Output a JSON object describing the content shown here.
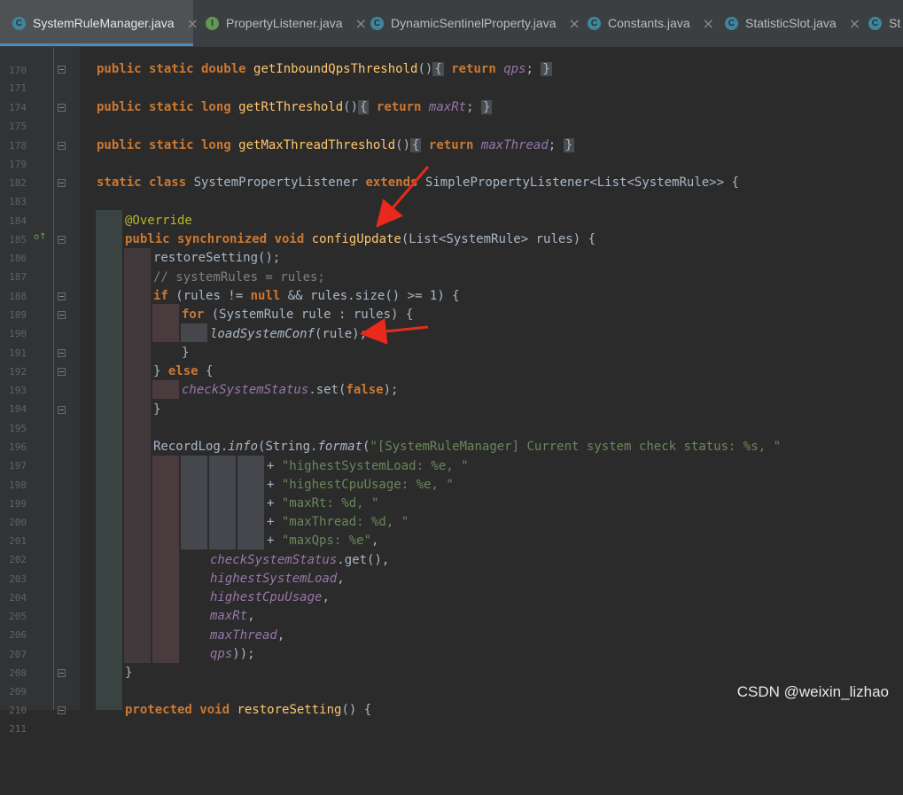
{
  "tabs": [
    {
      "label": "SystemRuleManager.java",
      "icon": "class-icon",
      "icon_letter": "C",
      "active": true
    },
    {
      "label": "PropertyListener.java",
      "icon": "interface-icon",
      "icon_letter": "I",
      "active": false
    },
    {
      "label": "DynamicSentinelProperty.java",
      "icon": "class-icon",
      "icon_letter": "C",
      "active": false
    },
    {
      "label": "Constants.java",
      "icon": "class-icon",
      "icon_letter": "C",
      "active": false
    },
    {
      "label": "StatisticSlot.java",
      "icon": "class-icon",
      "icon_letter": "C",
      "active": false
    },
    {
      "label": "St",
      "icon": "class-icon",
      "icon_letter": "C",
      "active": false
    }
  ],
  "tab_close_glyph": "×",
  "line_numbers": [
    "170",
    "171",
    "174",
    "175",
    "178",
    "179",
    "182",
    "183",
    "184",
    "185",
    "186",
    "187",
    "188",
    "189",
    "190",
    "191",
    "192",
    "193",
    "194",
    "195",
    "196",
    "197",
    "198",
    "199",
    "200",
    "201",
    "202",
    "203",
    "204",
    "205",
    "206",
    "207",
    "208",
    "209",
    "210",
    "211"
  ],
  "code": {
    "l171": {
      "kw": "public static double ",
      "name": "getInboundQpsThreshold",
      "p": "()",
      "ret": "return ",
      "fld": "qps",
      "end": ";"
    },
    "l175": {
      "kw": "public static long ",
      "name": "getRtThreshold",
      "p": "()",
      "ret": "return ",
      "fld": "maxRt",
      "end": ";"
    },
    "l179": {
      "kw": "public static long ",
      "name": "getMaxThreadThreshold",
      "p": "()",
      "ret": "return ",
      "fld": "maxThread",
      "end": ";"
    },
    "l183": {
      "kw1": "static class ",
      "name": "SystemPropertyListener ",
      "kw2": "extends ",
      "super": "SimplePropertyListener<List<SystemRule>> {"
    },
    "l185": {
      "ann": "@Override"
    },
    "l186": {
      "kw": "public synchronized void ",
      "name": "configUpdate",
      "rest": "(List<SystemRule> rules) {"
    },
    "l187": {
      "name": "restoreSetting",
      "rest": "();"
    },
    "l188": {
      "cmt": "// systemRules = rules;"
    },
    "l189": {
      "kw": "if ",
      "a": "(rules != ",
      "null": "null",
      "b": " && rules.size() >= 1) {"
    },
    "l190": {
      "kw": "for ",
      "rest": "(SystemRule rule : rules) {"
    },
    "l191": {
      "name": "loadSystemConf",
      "rest": "(rule);"
    },
    "l192": {
      "rest": "}"
    },
    "l193": {
      "a": "} ",
      "kw": "else ",
      "b": "{"
    },
    "l194": {
      "fld": "checkSystemStatus",
      "a": ".set(",
      "kw": "false",
      "b": ");"
    },
    "l195": {
      "rest": "}"
    },
    "l197": {
      "a": "RecordLog.",
      "info": "info",
      "b": "(String.",
      "fmt": "format",
      "c": "(",
      "str": "\"[SystemRuleManager] Current system check status: %s, \""
    },
    "l198": {
      "plus": "+ ",
      "str": "\"highestSystemLoad: %e, \""
    },
    "l199": {
      "plus": "+ ",
      "str": "\"highestCpuUsage: %e, \""
    },
    "l200": {
      "plus": "+ ",
      "str": "\"maxRt: %d, \""
    },
    "l201": {
      "plus": "+ ",
      "str": "\"maxThread: %d, \""
    },
    "l202": {
      "plus": "+ ",
      "str": "\"maxQps: %e\"",
      "end": ","
    },
    "l203": {
      "fld": "checkSystemStatus",
      "rest": ".get(),"
    },
    "l204": {
      "fld": "highestSystemLoad",
      "rest": ","
    },
    "l205": {
      "fld": "highestCpuUsage",
      "rest": ","
    },
    "l206": {
      "fld": "maxRt",
      "rest": ","
    },
    "l207": {
      "fld": "maxThread",
      "rest": ","
    },
    "l208": {
      "fld": "qps",
      "rest": "));"
    },
    "l209": {
      "rest": "}"
    },
    "l211": {
      "kw": "protected void ",
      "name": "restoreSetting",
      "rest": "() {"
    }
  },
  "watermark": "CSDN @weixin_lizhao",
  "colors": {
    "keyword": "#cc7832",
    "method": "#ffc66d",
    "field": "#9876aa",
    "string": "#6a8759",
    "annotation": "#bbb529",
    "arrow": "#e8291c"
  }
}
